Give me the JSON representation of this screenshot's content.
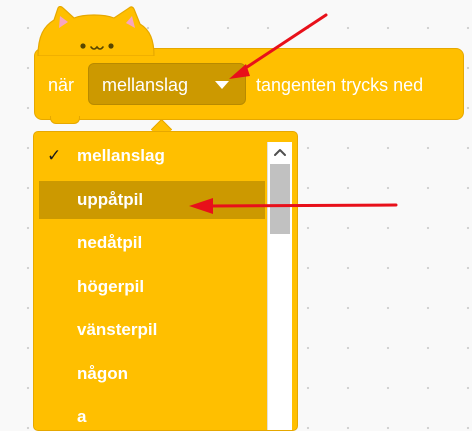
{
  "block": {
    "label_before": "när",
    "label_after": "tangenten trycks ned",
    "selected_key": "mellanslag"
  },
  "menu": {
    "check_symbol": "✓",
    "items": [
      {
        "label": "mellanslag",
        "checked": true
      },
      {
        "label": "uppåtpil",
        "highlighted": true
      },
      {
        "label": "nedåtpil"
      },
      {
        "label": "högerpil"
      },
      {
        "label": "vänsterpil"
      },
      {
        "label": "någon"
      },
      {
        "label": "a"
      }
    ]
  },
  "colors": {
    "block_fill": "#ffbf00",
    "dropdown_fill": "#cc9900",
    "highlight": "#cc9900",
    "annotation_arrow": "#e8101a",
    "text": "#ffffff"
  },
  "icons": [
    "cat-head-icon",
    "caret-down-icon",
    "check-icon",
    "scroll-up-chevron-icon"
  ]
}
